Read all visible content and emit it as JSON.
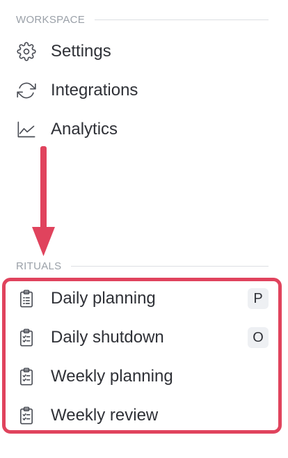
{
  "workspace": {
    "title": "WORKSPACE",
    "items": [
      {
        "label": "Settings",
        "icon": "gear-icon"
      },
      {
        "label": "Integrations",
        "icon": "sync-icon"
      },
      {
        "label": "Analytics",
        "icon": "line-chart-icon"
      }
    ]
  },
  "rituals": {
    "title": "RITUALS",
    "items": [
      {
        "label": "Daily planning",
        "icon": "clipboard-list-icon",
        "shortcut": "P"
      },
      {
        "label": "Daily shutdown",
        "icon": "clipboard-check-icon",
        "shortcut": "O"
      },
      {
        "label": "Weekly planning",
        "icon": "clipboard-check-icon"
      },
      {
        "label": "Weekly review",
        "icon": "clipboard-check-icon"
      }
    ]
  },
  "colors": {
    "highlight": "#e0435d",
    "text": "#2f3137",
    "section_title": "#9aa0a8",
    "shortcut_bg": "#eef0f3"
  }
}
